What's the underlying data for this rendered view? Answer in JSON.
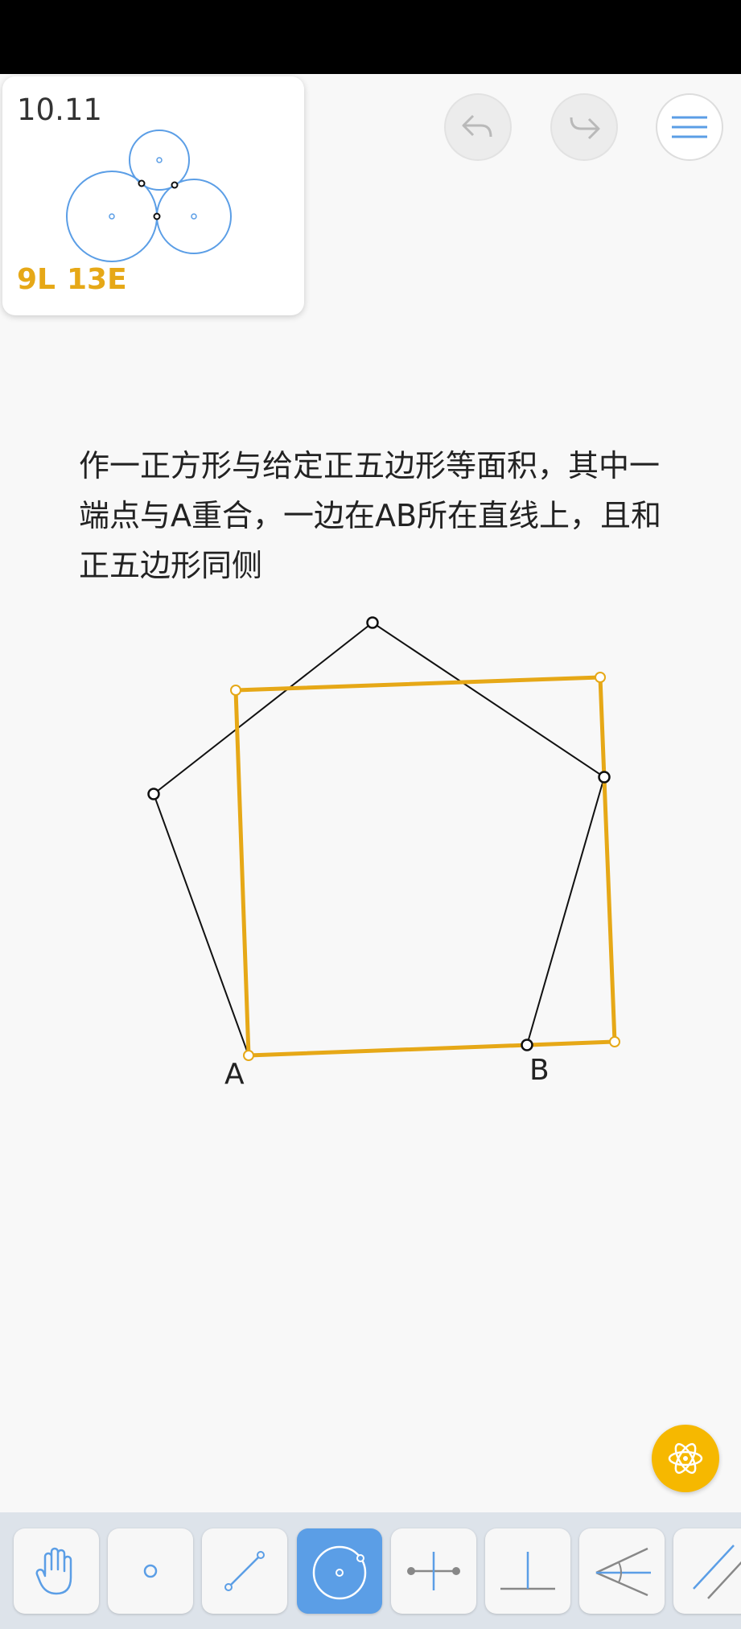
{
  "level": {
    "number": "10.11",
    "lines_score": "9L",
    "euclid_score": "13E"
  },
  "header": {
    "undo_icon": "undo-arrow-icon",
    "redo_icon": "redo-arrow-icon",
    "menu_icon": "hamburger-menu-icon"
  },
  "problem": {
    "text": "作一正方形与给定正五边形等面积，其中一端点与A重合，一边在AB所在直线上，且和正五边形同侧"
  },
  "figure": {
    "point_labels": {
      "A": "A",
      "B": "B"
    },
    "colors": {
      "given": "#111111",
      "solution": "#e6a817"
    }
  },
  "hint": {
    "icon": "atom-icon"
  },
  "toolbar": {
    "tools": [
      {
        "name": "move",
        "icon": "hand-icon",
        "active": false
      },
      {
        "name": "point",
        "icon": "point-icon",
        "active": false
      },
      {
        "name": "line",
        "icon": "line-segment-icon",
        "active": false
      },
      {
        "name": "circle",
        "icon": "circle-icon",
        "active": true
      },
      {
        "name": "perpendicular-bisector",
        "icon": "perpendicular-bisector-icon",
        "active": false
      },
      {
        "name": "perpendicular",
        "icon": "perpendicular-icon",
        "active": false
      },
      {
        "name": "angle-bisector",
        "icon": "angle-bisector-icon",
        "active": false
      },
      {
        "name": "parallel",
        "icon": "parallel-icon",
        "active": false
      }
    ]
  },
  "accent": "#5b9ee6"
}
